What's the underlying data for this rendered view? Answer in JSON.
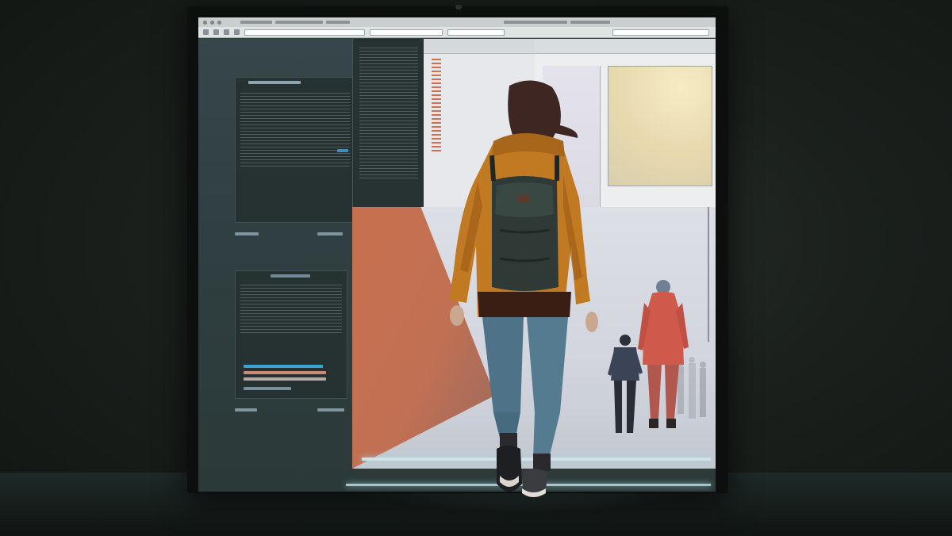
{
  "scene": {
    "description_colors": {
      "backdrop": "#161b18",
      "screen_panel": "#32403e",
      "jacket": "#c27a22",
      "backpack": "#2f3a37",
      "jeans": "#4e7388",
      "canvas_shape": "#c7704f",
      "distant_jacket": "#cf5a4c"
    }
  },
  "monitor": {
    "toolbar_icons": [
      "back-icon",
      "forward-icon",
      "refresh-icon",
      "home-icon"
    ],
    "panels": [
      "left-properties-panel",
      "file-tree-panel",
      "file-list-panel",
      "preview-panel",
      "canvas-panel"
    ]
  }
}
